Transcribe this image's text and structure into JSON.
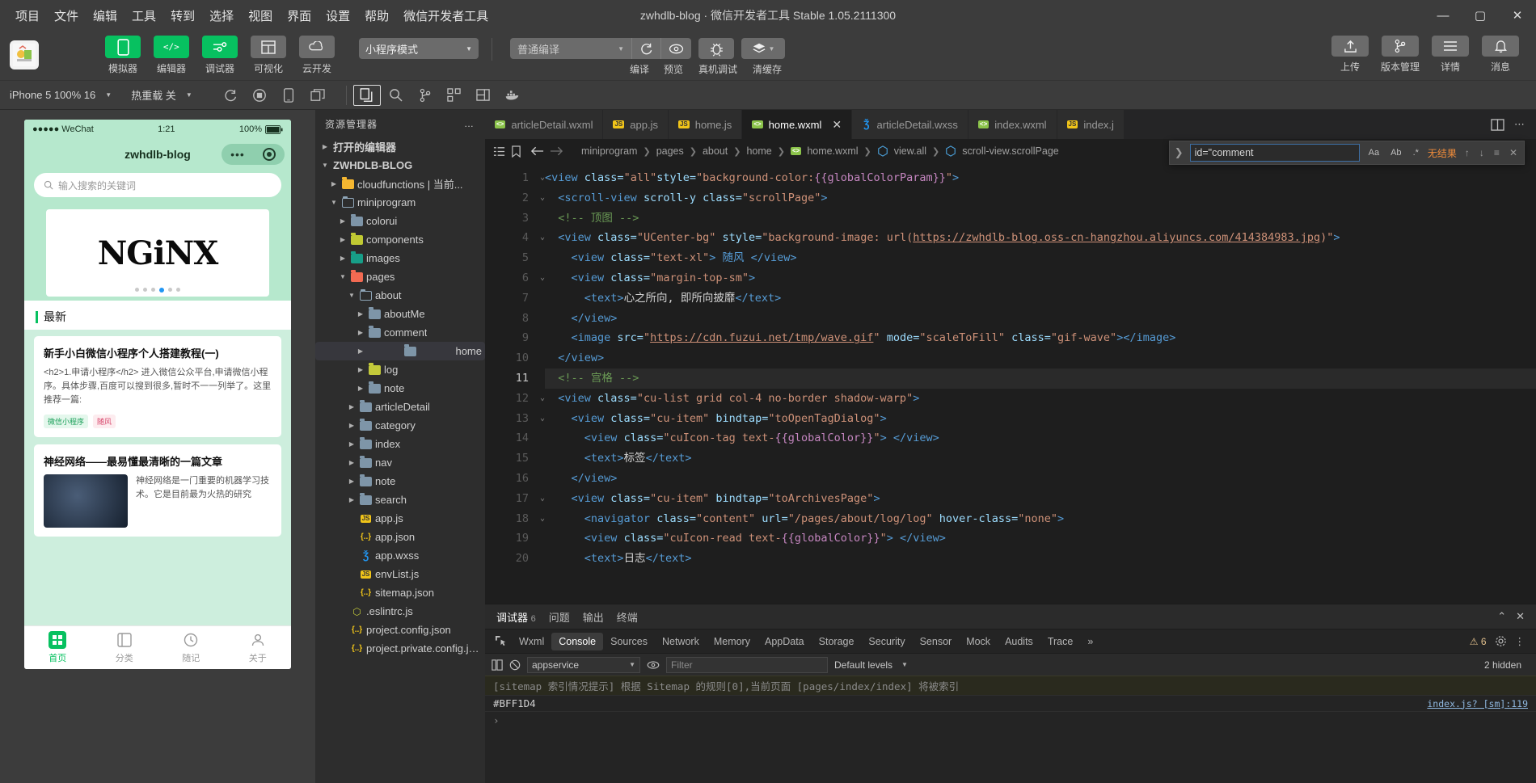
{
  "window": {
    "title": "zwhdlb-blog · 微信开发者工具 Stable 1.05.2111300",
    "minimize": "—",
    "maximize": "▢",
    "close": "✕"
  },
  "menu": [
    "项目",
    "文件",
    "编辑",
    "工具",
    "转到",
    "选择",
    "视图",
    "界面",
    "设置",
    "帮助",
    "微信开发者工具"
  ],
  "toolbar": {
    "buttons": [
      {
        "label": "模拟器",
        "icon": "phone-icon",
        "style": "green"
      },
      {
        "label": "编辑器",
        "icon": "code-icon",
        "style": "green"
      },
      {
        "label": "调试器",
        "icon": "sliders-icon",
        "style": "green"
      },
      {
        "label": "可视化",
        "icon": "layout-icon",
        "style": "grey"
      },
      {
        "label": "云开发",
        "icon": "cloud-icon",
        "style": "grey"
      }
    ],
    "mode_select": "小程序模式",
    "compile_select": "普通编译",
    "compile_label": "编译",
    "preview_label": "预览",
    "realdevice_label": "真机调试",
    "clearcache_label": "清缓存",
    "right": [
      {
        "label": "上传",
        "icon": "upload-icon"
      },
      {
        "label": "版本管理",
        "icon": "branch-icon"
      },
      {
        "label": "详情",
        "icon": "menu-icon"
      },
      {
        "label": "消息",
        "icon": "bell-icon"
      }
    ]
  },
  "subbar": {
    "device": "iPhone 5 100% 16",
    "hotreload": "热重载 关",
    "icons": [
      "refresh-icon",
      "stop-icon",
      "phone-icon",
      "window-icon",
      "files-icon",
      "search-icon",
      "branch-icon",
      "extensions-icon",
      "debug-icon",
      "docker-icon"
    ]
  },
  "simulator": {
    "status_left": "●●●●● WeChat",
    "status_time": "1:21",
    "status_right": "100%",
    "nav_title": "zwhdlb-blog",
    "search_placeholder": "输入搜索的关键词",
    "banner_text": "NGiNX",
    "section_title": "最新",
    "articles": [
      {
        "title": "新手小白微信小程序个人搭建教程(一)",
        "body": "<h2>1.申请小程序</h2> 进入微信公众平台,申请微信小程序。具体步骤,百度可以搜到很多,暂时不一一列举了。这里推荐一篇:",
        "tags": [
          "微信小程序",
          "随风"
        ]
      },
      {
        "title": "神经网络——最易懂最清晰的一篇文章",
        "body": "神经网络是一门重要的机器学习技术。它是目前最为火热的研究"
      }
    ],
    "tabbar": [
      "首页",
      "分类",
      "随记",
      "关于"
    ]
  },
  "explorer": {
    "title": "资源管理器",
    "more": "…",
    "open_editors": "打开的编辑器",
    "project": "ZWHDLB-BLOG",
    "tree": [
      {
        "label": "cloudfunctions | 当前...",
        "depth": 1,
        "type": "folder",
        "icon": "folder-yellow",
        "arrow": "▶"
      },
      {
        "label": "miniprogram",
        "depth": 1,
        "type": "folder",
        "icon": "folder-open",
        "arrow": "▼"
      },
      {
        "label": "colorui",
        "depth": 2,
        "type": "folder",
        "icon": "folder",
        "arrow": "▶"
      },
      {
        "label": "components",
        "depth": 2,
        "type": "folder",
        "icon": "folder-lime",
        "arrow": "▶"
      },
      {
        "label": "images",
        "depth": 2,
        "type": "folder",
        "icon": "folder-teal",
        "arrow": "▶"
      },
      {
        "label": "pages",
        "depth": 2,
        "type": "folder",
        "icon": "folder-red",
        "arrow": "▼"
      },
      {
        "label": "about",
        "depth": 3,
        "type": "folder",
        "icon": "folder-open",
        "arrow": "▼"
      },
      {
        "label": "aboutMe",
        "depth": 4,
        "type": "folder",
        "icon": "folder",
        "arrow": "▶"
      },
      {
        "label": "comment",
        "depth": 4,
        "type": "folder",
        "icon": "folder",
        "arrow": "▶"
      },
      {
        "label": "home",
        "depth": 4,
        "type": "folder",
        "icon": "folder",
        "arrow": "▶",
        "selected": true
      },
      {
        "label": "log",
        "depth": 4,
        "type": "folder",
        "icon": "folder-olive",
        "arrow": "▶"
      },
      {
        "label": "note",
        "depth": 4,
        "type": "folder",
        "icon": "folder",
        "arrow": "▶"
      },
      {
        "label": "articleDetail",
        "depth": 3,
        "type": "folder",
        "icon": "folder",
        "arrow": "▶"
      },
      {
        "label": "category",
        "depth": 3,
        "type": "folder",
        "icon": "folder",
        "arrow": "▶"
      },
      {
        "label": "index",
        "depth": 3,
        "type": "folder",
        "icon": "folder",
        "arrow": "▶"
      },
      {
        "label": "nav",
        "depth": 3,
        "type": "folder",
        "icon": "folder",
        "arrow": "▶"
      },
      {
        "label": "note",
        "depth": 3,
        "type": "folder",
        "icon": "folder",
        "arrow": "▶"
      },
      {
        "label": "search",
        "depth": 3,
        "type": "folder",
        "icon": "folder",
        "arrow": "▶"
      },
      {
        "label": "app.js",
        "depth": 3,
        "type": "file",
        "icon": "js"
      },
      {
        "label": "app.json",
        "depth": 3,
        "type": "file",
        "icon": "json"
      },
      {
        "label": "app.wxss",
        "depth": 3,
        "type": "file",
        "icon": "wxss"
      },
      {
        "label": "envList.js",
        "depth": 3,
        "type": "file",
        "icon": "js"
      },
      {
        "label": "sitemap.json",
        "depth": 3,
        "type": "file",
        "icon": "json"
      },
      {
        "label": ".eslintrc.js",
        "depth": 2,
        "type": "file",
        "icon": "es"
      },
      {
        "label": "project.config.json",
        "depth": 2,
        "type": "file",
        "icon": "json"
      },
      {
        "label": "project.private.config.js...",
        "depth": 2,
        "type": "file",
        "icon": "json"
      }
    ]
  },
  "editor": {
    "tabs": [
      {
        "label": "articleDetail.wxml",
        "icon": "wxml",
        "active": false
      },
      {
        "label": "app.js",
        "icon": "js",
        "active": false
      },
      {
        "label": "home.js",
        "icon": "js",
        "active": false
      },
      {
        "label": "home.wxml",
        "icon": "wxml",
        "active": true
      },
      {
        "label": "articleDetail.wxss",
        "icon": "wxss",
        "active": false
      },
      {
        "label": "index.wxml",
        "icon": "wxml",
        "active": false
      },
      {
        "label": "index.j",
        "icon": "js",
        "active": false
      }
    ],
    "tabs_right": [
      "split-editor-icon",
      "more-icon"
    ],
    "breadcrumb": [
      "miniprogram",
      "pages",
      "about",
      "home",
      "home.wxml",
      "view.all",
      "scroll-view.scrollPage"
    ],
    "find": {
      "query": "id=\"comment",
      "match_case": "Aa",
      "whole_word": "Ab",
      "regex": ".*",
      "result": "无结果",
      "prev": "↑",
      "next": "↓",
      "selection": "≡",
      "close": "✕"
    },
    "lines": [
      {
        "n": 1,
        "fold": "⌄",
        "indent": 0,
        "tokens": [
          {
            "t": "<view ",
            "c": "tagc"
          },
          {
            "t": "class=",
            "c": "attr"
          },
          {
            "t": "\"all\"",
            "c": "str"
          },
          {
            "t": "style=",
            "c": "attr"
          },
          {
            "t": "\"background-color:",
            "c": "str"
          },
          {
            "t": "{{globalColorParam}}",
            "c": "mus"
          },
          {
            "t": "\"",
            "c": "str"
          },
          {
            "t": ">",
            "c": "tagc"
          }
        ]
      },
      {
        "n": 2,
        "fold": "⌄",
        "indent": 1,
        "tokens": [
          {
            "t": "<scroll-view ",
            "c": "tagc"
          },
          {
            "t": "scroll-y ",
            "c": "attr"
          },
          {
            "t": "class=",
            "c": "attr"
          },
          {
            "t": "\"scrollPage\"",
            "c": "str"
          },
          {
            "t": ">",
            "c": "tagc"
          }
        ]
      },
      {
        "n": 3,
        "fold": "",
        "indent": 1,
        "tokens": [
          {
            "t": "<!-- 顶图 -->",
            "c": "cmt"
          }
        ]
      },
      {
        "n": 4,
        "fold": "⌄",
        "indent": 1,
        "tokens": [
          {
            "t": "<view ",
            "c": "tagc"
          },
          {
            "t": "class=",
            "c": "attr"
          },
          {
            "t": "\"UCenter-bg\" ",
            "c": "str"
          },
          {
            "t": "style=",
            "c": "attr"
          },
          {
            "t": "\"background-image: url(",
            "c": "str"
          },
          {
            "t": "https://zwhdlb-blog.oss-cn-hangzhou.aliyuncs.com/414384983.jpg",
            "c": "lnk"
          },
          {
            "t": ")\"",
            "c": "str"
          },
          {
            "t": ">",
            "c": "tagc"
          }
        ]
      },
      {
        "n": 5,
        "fold": "",
        "indent": 2,
        "tokens": [
          {
            "t": "<view ",
            "c": "tagc"
          },
          {
            "t": "class=",
            "c": "attr"
          },
          {
            "t": "\"text-xl\"",
            "c": "str"
          },
          {
            "t": "> 随风 ",
            "c": "tagc"
          },
          {
            "t": "</view>",
            "c": "tagc"
          }
        ]
      },
      {
        "n": 6,
        "fold": "⌄",
        "indent": 2,
        "tokens": [
          {
            "t": "<view ",
            "c": "tagc"
          },
          {
            "t": "class=",
            "c": "attr"
          },
          {
            "t": "\"margin-top-sm\"",
            "c": "str"
          },
          {
            "t": ">",
            "c": "tagc"
          }
        ]
      },
      {
        "n": 7,
        "fold": "",
        "indent": 3,
        "tokens": [
          {
            "t": "<text>",
            "c": "tagc"
          },
          {
            "t": "心之所向, 即所向披靡",
            "c": ""
          },
          {
            "t": "</text>",
            "c": "tagc"
          }
        ]
      },
      {
        "n": 8,
        "fold": "",
        "indent": 2,
        "tokens": [
          {
            "t": "</view>",
            "c": "tagc"
          }
        ]
      },
      {
        "n": 9,
        "fold": "",
        "indent": 2,
        "tokens": [
          {
            "t": "<image ",
            "c": "tagc"
          },
          {
            "t": "src=",
            "c": "attr"
          },
          {
            "t": "\"",
            "c": "str"
          },
          {
            "t": "https://cdn.fuzui.net/tmp/wave.gif",
            "c": "lnk"
          },
          {
            "t": "\" ",
            "c": "str"
          },
          {
            "t": "mode=",
            "c": "attr"
          },
          {
            "t": "\"scaleToFill\" ",
            "c": "str"
          },
          {
            "t": "class=",
            "c": "attr"
          },
          {
            "t": "\"gif-wave\"",
            "c": "str"
          },
          {
            "t": ">",
            "c": "tagc"
          },
          {
            "t": "</image>",
            "c": "tagc"
          }
        ]
      },
      {
        "n": 10,
        "fold": "",
        "indent": 1,
        "tokens": [
          {
            "t": "</view>",
            "c": "tagc"
          }
        ]
      },
      {
        "n": 11,
        "fold": "",
        "indent": 1,
        "hl": true,
        "tokens": [
          {
            "t": "<!-- 宫格 -->",
            "c": "cmt"
          }
        ]
      },
      {
        "n": 12,
        "fold": "⌄",
        "indent": 1,
        "tokens": [
          {
            "t": "<view ",
            "c": "tagc"
          },
          {
            "t": "class=",
            "c": "attr"
          },
          {
            "t": "\"cu-list grid col-4 no-border shadow-warp\"",
            "c": "str"
          },
          {
            "t": ">",
            "c": "tagc"
          }
        ]
      },
      {
        "n": 13,
        "fold": "⌄",
        "indent": 2,
        "tokens": [
          {
            "t": "<view ",
            "c": "tagc"
          },
          {
            "t": "class=",
            "c": "attr"
          },
          {
            "t": "\"cu-item\" ",
            "c": "str"
          },
          {
            "t": "bindtap=",
            "c": "attr"
          },
          {
            "t": "\"toOpenTagDialog\"",
            "c": "str"
          },
          {
            "t": ">",
            "c": "tagc"
          }
        ]
      },
      {
        "n": 14,
        "fold": "",
        "indent": 3,
        "tokens": [
          {
            "t": "<view ",
            "c": "tagc"
          },
          {
            "t": "class=",
            "c": "attr"
          },
          {
            "t": "\"cuIcon-tag text-",
            "c": "str"
          },
          {
            "t": "{{globalColor}}",
            "c": "mus"
          },
          {
            "t": "\"",
            "c": "str"
          },
          {
            "t": "> ",
            "c": "tagc"
          },
          {
            "t": "</view>",
            "c": "tagc"
          }
        ]
      },
      {
        "n": 15,
        "fold": "",
        "indent": 3,
        "tokens": [
          {
            "t": "<text>",
            "c": "tagc"
          },
          {
            "t": "标签",
            "c": ""
          },
          {
            "t": "</text>",
            "c": "tagc"
          }
        ]
      },
      {
        "n": 16,
        "fold": "",
        "indent": 2,
        "tokens": [
          {
            "t": "</view>",
            "c": "tagc"
          }
        ]
      },
      {
        "n": 17,
        "fold": "⌄",
        "indent": 2,
        "tokens": [
          {
            "t": "<view ",
            "c": "tagc"
          },
          {
            "t": "class=",
            "c": "attr"
          },
          {
            "t": "\"cu-item\" ",
            "c": "str"
          },
          {
            "t": "bindtap=",
            "c": "attr"
          },
          {
            "t": "\"toArchivesPage\"",
            "c": "str"
          },
          {
            "t": ">",
            "c": "tagc"
          }
        ]
      },
      {
        "n": 18,
        "fold": "⌄",
        "indent": 3,
        "tokens": [
          {
            "t": "<navigator ",
            "c": "tagc"
          },
          {
            "t": "class=",
            "c": "attr"
          },
          {
            "t": "\"content\" ",
            "c": "str"
          },
          {
            "t": "url=",
            "c": "attr"
          },
          {
            "t": "\"/pages/about/log/log\" ",
            "c": "str"
          },
          {
            "t": "hover-class=",
            "c": "attr"
          },
          {
            "t": "\"none\"",
            "c": "str"
          },
          {
            "t": ">",
            "c": "tagc"
          }
        ]
      },
      {
        "n": 19,
        "fold": "",
        "indent": 3,
        "tokens": [
          {
            "t": "<view ",
            "c": "tagc"
          },
          {
            "t": "class=",
            "c": "attr"
          },
          {
            "t": "\"cuIcon-read text-",
            "c": "str"
          },
          {
            "t": "{{globalColor}}",
            "c": "mus"
          },
          {
            "t": "\"",
            "c": "str"
          },
          {
            "t": "> ",
            "c": "tagc"
          },
          {
            "t": "</view>",
            "c": "tagc"
          }
        ]
      },
      {
        "n": 20,
        "fold": "",
        "indent": 3,
        "tokens": [
          {
            "t": "<text>",
            "c": "tagc"
          },
          {
            "t": "日志",
            "c": ""
          },
          {
            "t": "</text>",
            "c": "tagc"
          }
        ]
      }
    ]
  },
  "debugger": {
    "tabs": [
      {
        "label": "调试器",
        "count": "6",
        "active": true
      },
      {
        "label": "问题",
        "active": false
      },
      {
        "label": "输出",
        "active": false
      },
      {
        "label": "终端",
        "active": false
      }
    ],
    "panel_controls": [
      "collapse-icon",
      "close-icon"
    ],
    "devtools_tabs": [
      "Wxml",
      "Console",
      "Sources",
      "Network",
      "Memory",
      "AppData",
      "Storage",
      "Security",
      "Sensor",
      "Mock",
      "Audits",
      "Trace"
    ],
    "devtools_active": "Console",
    "overflow": "»",
    "warnings": "6",
    "console": {
      "context": "appservice",
      "filter_placeholder": "Filter",
      "levels": "Default levels",
      "hidden": "2 hidden",
      "lines": [
        {
          "text": "[sitemap 索引情况提示] 根据 Sitemap 的规则[0],当前页面 [pages/index/index] 将被索引",
          "source": ""
        },
        {
          "text": "#BFF1D4",
          "source": "index.js? [sm]:119"
        }
      ],
      "prompt": "›"
    }
  }
}
